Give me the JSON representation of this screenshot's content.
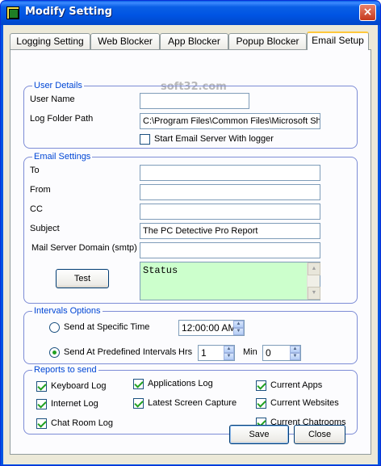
{
  "window": {
    "title": "Modify Setting",
    "close_glyph": "×"
  },
  "tabs": [
    {
      "label": "Logging Setting"
    },
    {
      "label": "Web Blocker"
    },
    {
      "label": "App Blocker"
    },
    {
      "label": "Popup Blocker"
    },
    {
      "label": "Email Setup",
      "active": true
    }
  ],
  "watermark": "soft32.com",
  "user_details": {
    "legend": "User Details",
    "user_name_label": "User Name",
    "user_name_value": "",
    "log_folder_label": "Log Folder Path",
    "log_folder_value": "C:\\Program Files\\Common Files\\Microsoft  Sh",
    "start_server_label": "Start Email Server With logger",
    "start_server_checked": false
  },
  "email_settings": {
    "legend": "Email Settings",
    "to_label": "To",
    "to_value": "",
    "from_label": "From",
    "from_value": "",
    "cc_label": "CC",
    "cc_value": "",
    "subject_label": "Subject",
    "subject_value": "The PC Detective Pro Report",
    "smtp_label": "Mail Server Domain (smtp)",
    "smtp_value": "",
    "test_button": "Test",
    "status_text": "Status",
    "status_color": "#ccffcc"
  },
  "intervals": {
    "legend": "Intervals Options",
    "specific_time_label": "Send at Specific Time",
    "specific_time_checked": false,
    "time_value": "12:00:00 AM",
    "predefined_label": "Send At Predefined Intervals",
    "predefined_checked": true,
    "hrs_label": "Hrs",
    "hrs_value": "1",
    "min_label": "Min",
    "min_value": "0"
  },
  "reports": {
    "legend": "Reports to send",
    "items": [
      {
        "label": "Keyboard Log",
        "checked": true
      },
      {
        "label": "Applications Log",
        "checked": true
      },
      {
        "label": "Current Apps",
        "checked": true
      },
      {
        "label": "Internet Log",
        "checked": true
      },
      {
        "label": "Latest Screen Capture",
        "checked": true
      },
      {
        "label": "Current Websites",
        "checked": true
      },
      {
        "label": "Chat Room Log",
        "checked": true
      },
      {
        "label": "Current Chatrooms",
        "checked": true
      }
    ]
  },
  "buttons": {
    "save": "Save",
    "close": "Close"
  },
  "colors": {
    "titlebar": "#0054e3",
    "legend": "#0046d5",
    "active_tab_accent": "#ffc83c",
    "check": "#21a121"
  }
}
